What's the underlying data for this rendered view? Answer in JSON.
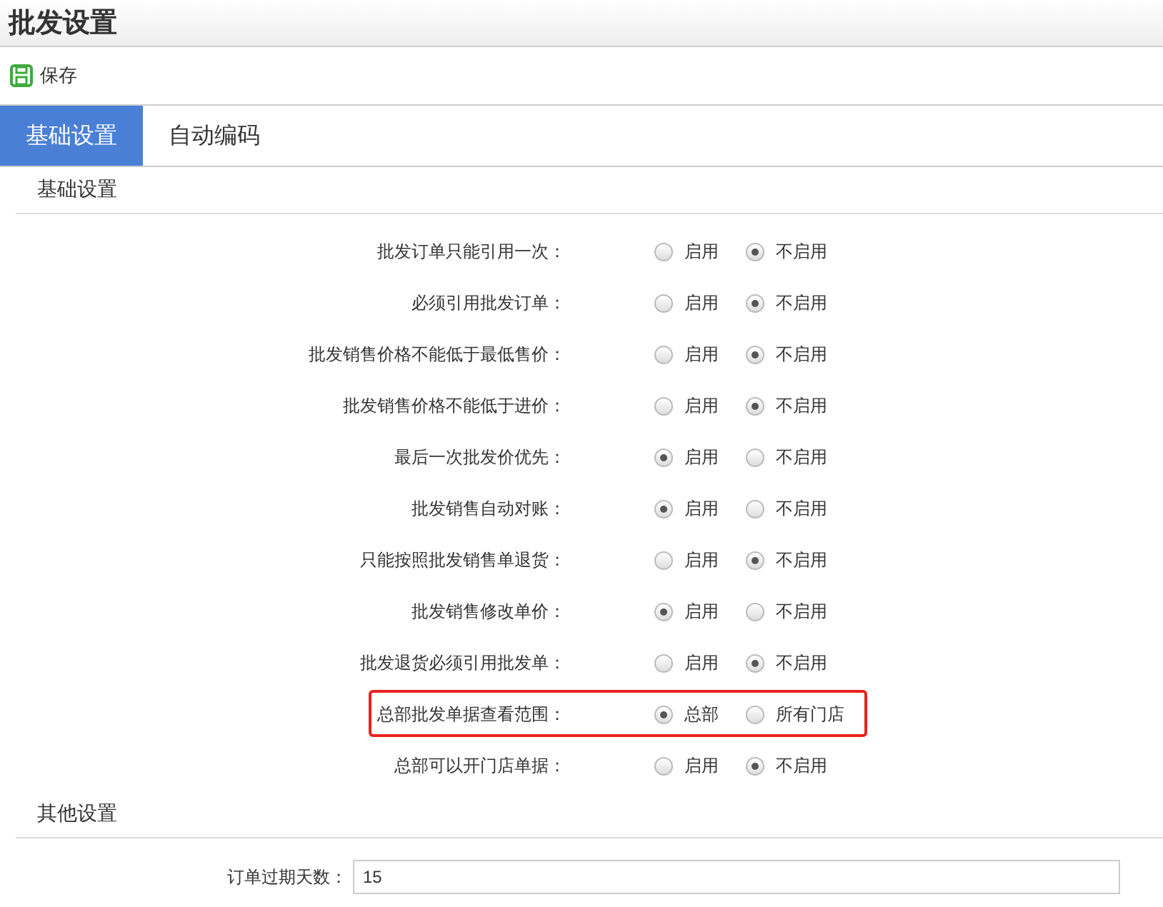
{
  "window": {
    "title": "批发设置"
  },
  "toolbar": {
    "save": "保存"
  },
  "tabs": [
    {
      "label": "基础设置",
      "selected": true
    },
    {
      "label": "自动编码",
      "selected": false
    }
  ],
  "sections": [
    {
      "title": "基础设置",
      "rows": [
        {
          "label": "批发订单只能引用一次：",
          "highlighted": false,
          "options": [
            {
              "label": "启用",
              "selected": false
            },
            {
              "label": "不启用",
              "selected": true
            }
          ]
        },
        {
          "label": "必须引用批发订单：",
          "highlighted": false,
          "options": [
            {
              "label": "启用",
              "selected": false
            },
            {
              "label": "不启用",
              "selected": true
            }
          ]
        },
        {
          "label": "批发销售价格不能低于最低售价：",
          "highlighted": false,
          "options": [
            {
              "label": "启用",
              "selected": false
            },
            {
              "label": "不启用",
              "selected": true
            }
          ]
        },
        {
          "label": "批发销售价格不能低于进价：",
          "highlighted": false,
          "options": [
            {
              "label": "启用",
              "selected": false
            },
            {
              "label": "不启用",
              "selected": true
            }
          ]
        },
        {
          "label": "最后一次批发价优先：",
          "highlighted": false,
          "options": [
            {
              "label": "启用",
              "selected": true
            },
            {
              "label": "不启用",
              "selected": false
            }
          ]
        },
        {
          "label": "批发销售自动对账：",
          "highlighted": false,
          "options": [
            {
              "label": "启用",
              "selected": true
            },
            {
              "label": "不启用",
              "selected": false
            }
          ]
        },
        {
          "label": "只能按照批发销售单退货：",
          "highlighted": false,
          "options": [
            {
              "label": "启用",
              "selected": false
            },
            {
              "label": "不启用",
              "selected": true
            }
          ]
        },
        {
          "label": "批发销售修改单价：",
          "highlighted": false,
          "options": [
            {
              "label": "启用",
              "selected": true
            },
            {
              "label": "不启用",
              "selected": false
            }
          ]
        },
        {
          "label": "批发退货必须引用批发单：",
          "highlighted": false,
          "options": [
            {
              "label": "启用",
              "selected": false
            },
            {
              "label": "不启用",
              "selected": true
            }
          ]
        },
        {
          "label": "总部批发单据查看范围：",
          "highlighted": true,
          "options": [
            {
              "label": "总部",
              "selected": true
            },
            {
              "label": "所有门店",
              "selected": false
            }
          ]
        },
        {
          "label": "总部可以开门店单据：",
          "highlighted": false,
          "options": [
            {
              "label": "启用",
              "selected": false
            },
            {
              "label": "不启用",
              "selected": true
            }
          ]
        }
      ]
    },
    {
      "title": "其他设置",
      "fields": [
        {
          "label": "订单过期天数：",
          "value": "15"
        }
      ]
    }
  ]
}
